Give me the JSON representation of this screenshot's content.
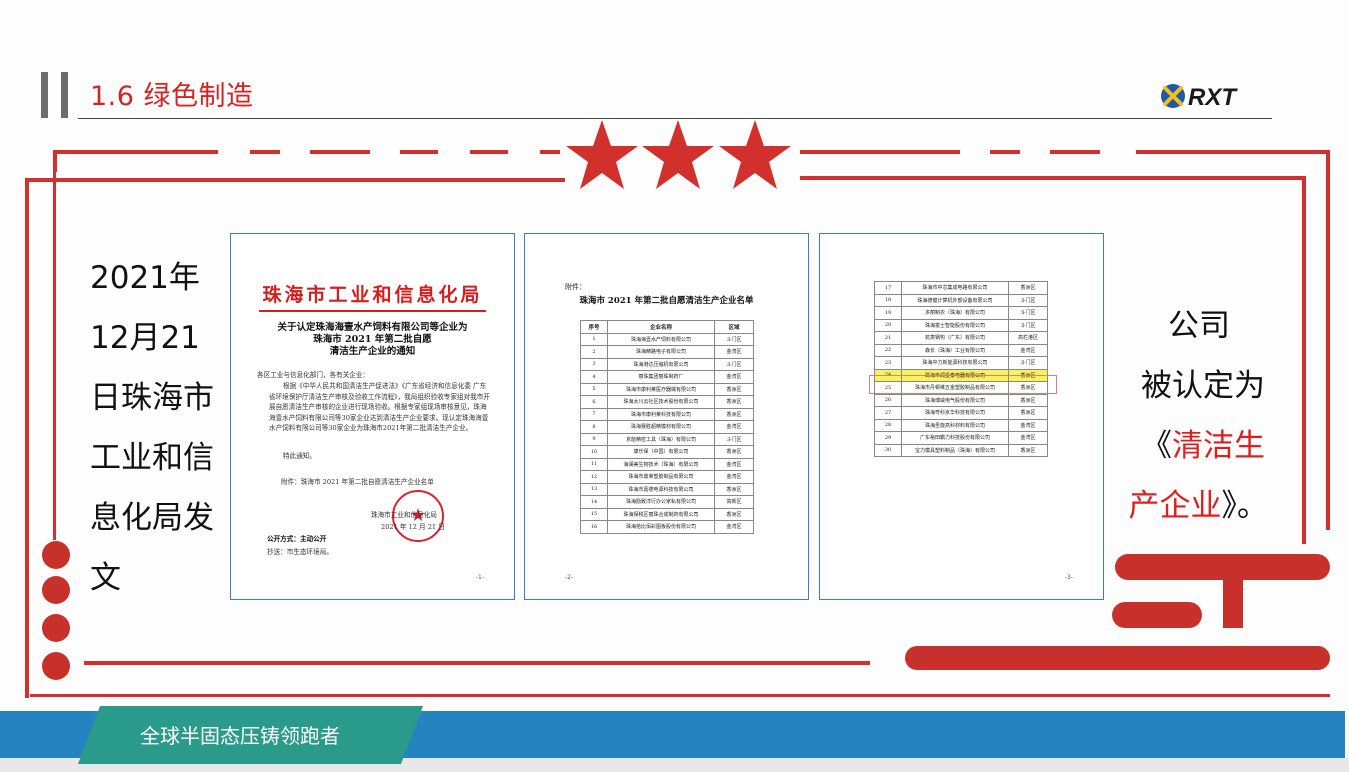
{
  "header": {
    "title": "1.6 绿色制造",
    "logo_text": "RXT"
  },
  "left_text": [
    "2021年",
    "12月21",
    "日珠海市",
    "工业和信",
    "息化局发",
    "文"
  ],
  "right_text": {
    "line1": "公司",
    "line2": "被认定为",
    "line3_prefix": "《",
    "line3_highlight": "清洁生",
    "line4_highlight": "产企业",
    "line4_suffix": "》。"
  },
  "doc1": {
    "title": "珠海市工业和信息化局",
    "subtitle_l1": "关于认定珠海海壹水产饲料有限公司等企业为",
    "subtitle_l2": "珠海市 2021 年第二批自愿",
    "subtitle_l3": "清洁生产企业的通知",
    "greeting": "各区工业与信息化部门，各有关企业：",
    "body": "根据《中华人民共和国清洁生产促进法》《广东省经济和信息化委 广东省环境保护厅清洁生产审核及验收工作流程》，我局组织验收专家组对我市开展自愿清洁生产审核的企业进行现场验收。根据专家组现场审核意见，珠海海壹水产饲料有限公司等30家企业达到清洁生产企业要求。现认定珠海海壹水产饲料有限公司等30家企业为珠海市2021年第二批清洁生产企业。",
    "closing": "特此通知。",
    "attachment": "附件：珠海市 2021 年第二批自愿清洁生产企业名单",
    "signer": "珠海市工业和信息化局",
    "date": "2021 年 12 月 21 日",
    "disclosure": "公开方式：主动公开",
    "cc": "抄送：市生态环境局。",
    "page": "-1-"
  },
  "doc2": {
    "attach_label": "附件：",
    "title": "珠海市 2021 年第二批自愿清洁生产企业名单",
    "headers": [
      "序号",
      "企业名称",
      "区域"
    ],
    "rows": [
      [
        "1",
        "珠海海壹水产饲料有限公司",
        "斗门区"
      ],
      [
        "2",
        "珠海精路电子有限公司",
        "金湾区"
      ],
      [
        "3",
        "珠海港达压缩机有限公司",
        "斗门区"
      ],
      [
        "4",
        "丽珠集团丽珠制药厂",
        "金湾区"
      ],
      [
        "5",
        "珠海市康利莱医疗器械有限公司",
        "香洲区"
      ],
      [
        "6",
        "珠海太川云社区技术股份有限公司",
        "香洲区"
      ],
      [
        "7",
        "珠海市康利莱科技有限公司",
        "香洲区"
      ],
      [
        "8",
        "珠海赛胜超精模材有限公司",
        "金湾区"
      ],
      [
        "9",
        "京能精密工具（珠海）有限公司",
        "斗门区"
      ],
      [
        "10",
        "康乐保（中国）有限公司",
        "香洲区"
      ],
      [
        "11",
        "海澜美生物技术（珠海）有限公司",
        "金湾区"
      ],
      [
        "12",
        "珠海市鼎荣塑胶制品有限公司",
        "金湾区"
      ],
      [
        "13",
        "珠海市嘉德电源科技有限公司",
        "香洲区"
      ],
      [
        "14",
        "珠海励致洋行办公家私有限公司",
        "高新区"
      ],
      [
        "15",
        "珠海保税区丽珠合成制药有限公司",
        "香洲区"
      ],
      [
        "16",
        "珠海拾比佰彩图板股份有限公司",
        "金湾区"
      ]
    ],
    "page": "-2-"
  },
  "doc3": {
    "rows": [
      [
        "17",
        "珠海市中芯集成电路有限公司",
        "香洲区"
      ],
      [
        "18",
        "珠海德健计算机外部设备有限公司",
        "斗门区"
      ],
      [
        "19",
        "多丽制衣（珠海）有限公司",
        "斗门区"
      ],
      [
        "20",
        "珠海富士智能股份有限公司",
        "斗门区"
      ],
      [
        "21",
        "杭萧钢构（广东）有限公司",
        "高栏港区"
      ],
      [
        "22",
        "森长（珠海）工业有限公司",
        "金湾区"
      ],
      [
        "23",
        "珠海中力新能源科技有限公司",
        "斗门区"
      ],
      [
        "24",
        "珠海市润星泰电器有限公司",
        "香洲区"
      ],
      [
        "25",
        "珠海市丹顿维五金塑胶制品有限公司",
        "香洲区"
      ],
      [
        "26",
        "珠海博威电气股份有限公司",
        "香洲区"
      ],
      [
        "27",
        "珠海粤科京华科技有限公司",
        "香洲区"
      ],
      [
        "28",
        "珠海圣旋高科材料有限公司",
        "金湾区"
      ],
      [
        "29",
        "广东裕田霸力科技股份有限公司",
        "金湾区"
      ],
      [
        "30",
        "宝力模具塑料制品（珠海）有限公司",
        "香洲区"
      ]
    ],
    "highlight_row": 7,
    "page": "-3-"
  },
  "footer": {
    "tagline": "全球半固态压铸领跑者"
  },
  "colors": {
    "accent_red": "#d1302c",
    "title_red": "#d62222",
    "footer_blue": "#2584c0",
    "footer_teal": "#2a9a8a",
    "highlight_yellow": "#f7f35a"
  }
}
